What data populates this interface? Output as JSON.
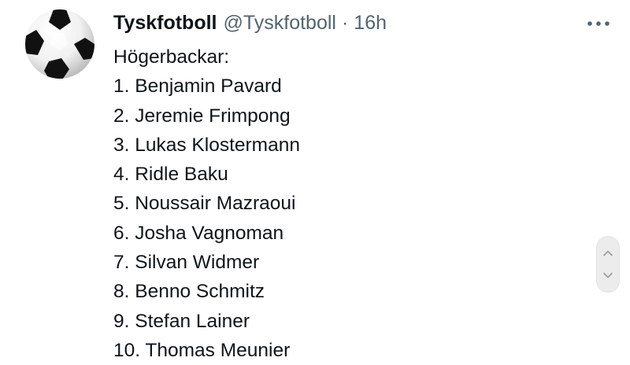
{
  "tweet": {
    "author": {
      "name": "Tyskfotboll",
      "handle": "@Tyskfotboll",
      "separator": "·",
      "time": "16h",
      "avatar_icon": "soccer-ball-icon"
    },
    "more_icon": "more-options-icon",
    "text_lines": [
      "Högerbackar:",
      "1. Benjamin Pavard",
      "2. Jeremie Frimpong",
      "3. Lukas Klostermann",
      "4. Ridle Baku",
      "5. Noussair Mazraoui",
      "6. Josha Vagnoman",
      "7. Silvan Widmer",
      "8. Benno Schmitz",
      "9. Stefan Lainer",
      "10. Thomas Meunier"
    ]
  },
  "scroll_control": {
    "up_icon": "chevron-up-icon",
    "down_icon": "chevron-down-icon"
  },
  "colors": {
    "text_primary": "#0f1419",
    "text_secondary": "#536471",
    "background": "#ffffff"
  }
}
